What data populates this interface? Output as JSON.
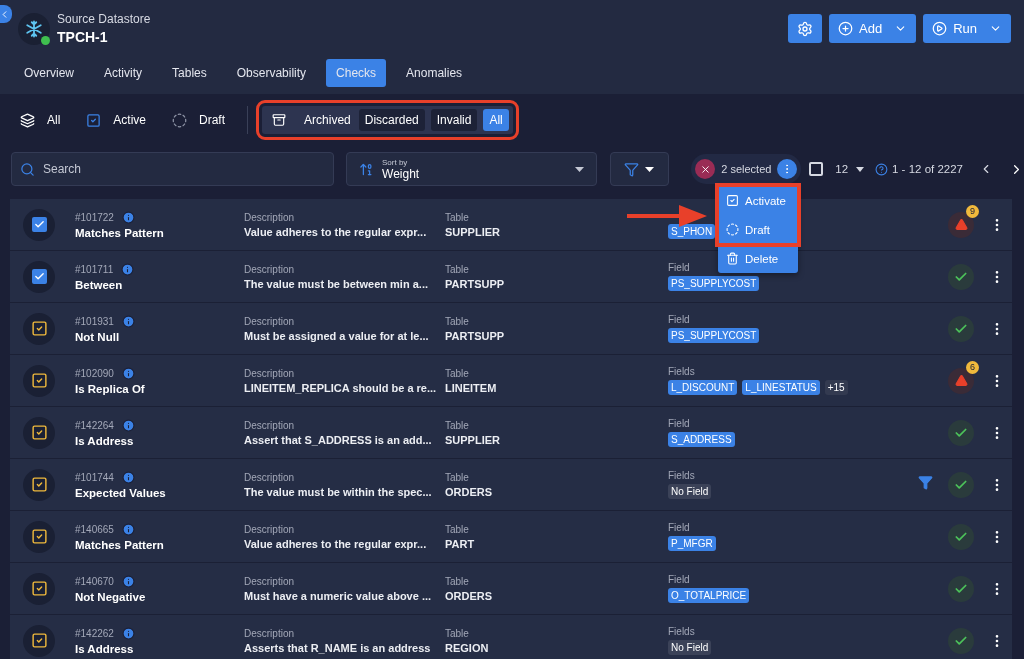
{
  "header": {
    "subtitle": "Source Datastore",
    "title": "TPCH-1",
    "online": true
  },
  "actions": [
    {
      "kind": "settings"
    },
    {
      "kind": "add",
      "label": "Add"
    },
    {
      "kind": "run",
      "label": "Run"
    }
  ],
  "tabs": [
    {
      "label": "Overview",
      "selected": false
    },
    {
      "label": "Activity",
      "selected": false
    },
    {
      "label": "Tables",
      "selected": false
    },
    {
      "label": "Observability",
      "selected": false
    },
    {
      "label": "Checks",
      "selected": true
    },
    {
      "label": "Anomalies",
      "selected": false
    }
  ],
  "status_filters": [
    {
      "kind": "all",
      "label": "All"
    },
    {
      "kind": "active",
      "label": "Active"
    },
    {
      "kind": "draft",
      "label": "Draft"
    }
  ],
  "archive_filters": {
    "label": "Archived",
    "options": [
      {
        "label": "Discarded",
        "selected": false
      },
      {
        "label": "Invalid",
        "selected": false
      },
      {
        "label": "All",
        "selected": true
      }
    ]
  },
  "search": {
    "placeholder": "Search"
  },
  "sort": {
    "label": "Sort by",
    "value": "Weight"
  },
  "selection": {
    "count": "2 selected",
    "all_selected": false,
    "page_size": "12",
    "range": "1 - 12 of 2227"
  },
  "menu": [
    {
      "kind": "activate",
      "label": "Activate"
    },
    {
      "kind": "draft",
      "label": "Draft"
    },
    {
      "kind": "delete",
      "label": "Delete"
    }
  ],
  "rows": [
    {
      "id": "#101722",
      "name": "Matches Pattern",
      "desc_label": "Description",
      "description": "Value adheres to the regular expr...",
      "table_label": "Table",
      "table": "SUPPLIER",
      "fields": [
        "S_PHON"
      ],
      "filtered": false,
      "kind": "warning",
      "count": "9",
      "selected": true
    },
    {
      "id": "#101711",
      "name": "Between",
      "desc_label": "Description",
      "description": "The value must be between min a...",
      "table_label": "Table",
      "table": "PARTSUPP",
      "field_label": "Field",
      "fields": [
        "PS_SUPPLYCOST"
      ],
      "filtered": false,
      "kind": "passed",
      "selected": true
    },
    {
      "id": "#101931",
      "name": "Not Null",
      "desc_label": "Description",
      "description": "Must be assigned a value for at le...",
      "table_label": "Table",
      "table": "PARTSUPP",
      "field_label": "Field",
      "fields": [
        "PS_SUPPLYCOST"
      ],
      "filtered": false,
      "kind": "passed",
      "selected": false
    },
    {
      "id": "#102090",
      "name": "Is Replica Of",
      "desc_label": "Description",
      "description": "LINEITEM_REPLICA should be a re...",
      "table_label": "Table",
      "table": "LINEITEM",
      "field_label": "Fields",
      "fields": [
        "L_DISCOUNT",
        "L_LINESTATUS"
      ],
      "more": "+15",
      "filtered": false,
      "kind": "warning",
      "count": "6",
      "selected": false
    },
    {
      "id": "#142264",
      "name": "Is Address",
      "desc_label": "Description",
      "description": "Assert that S_ADDRESS is an add...",
      "table_label": "Table",
      "table": "SUPPLIER",
      "field_label": "Field",
      "fields": [
        "S_ADDRESS"
      ],
      "filtered": false,
      "kind": "passed",
      "selected": false
    },
    {
      "id": "#101744",
      "name": "Expected Values",
      "desc_label": "Description",
      "description": "The value must be within the spec...",
      "table_label": "Table",
      "table": "ORDERS",
      "field_label": "Fields",
      "fields": [],
      "empty": "No Field",
      "filtered": true,
      "kind": "passed",
      "selected": false
    },
    {
      "id": "#140665",
      "name": "Matches Pattern",
      "desc_label": "Description",
      "description": "Value adheres to the regular expr...",
      "table_label": "Table",
      "table": "PART",
      "field_label": "Field",
      "fields": [
        "P_MFGR"
      ],
      "filtered": false,
      "kind": "passed",
      "selected": false
    },
    {
      "id": "#140670",
      "name": "Not Negative",
      "desc_label": "Description",
      "description": "Must have a numeric value above ...",
      "table_label": "Table",
      "table": "ORDERS",
      "field_label": "Field",
      "fields": [
        "O_TOTALPRICE"
      ],
      "filtered": false,
      "kind": "passed",
      "selected": false
    },
    {
      "id": "#142262",
      "name": "Is Address",
      "desc_label": "Description",
      "description": "Asserts that R_NAME is an address",
      "table_label": "Table",
      "table": "REGION",
      "field_label": "Fields",
      "fields": [],
      "empty": "No Field",
      "filtered": false,
      "kind": "passed",
      "selected": false
    }
  ]
}
